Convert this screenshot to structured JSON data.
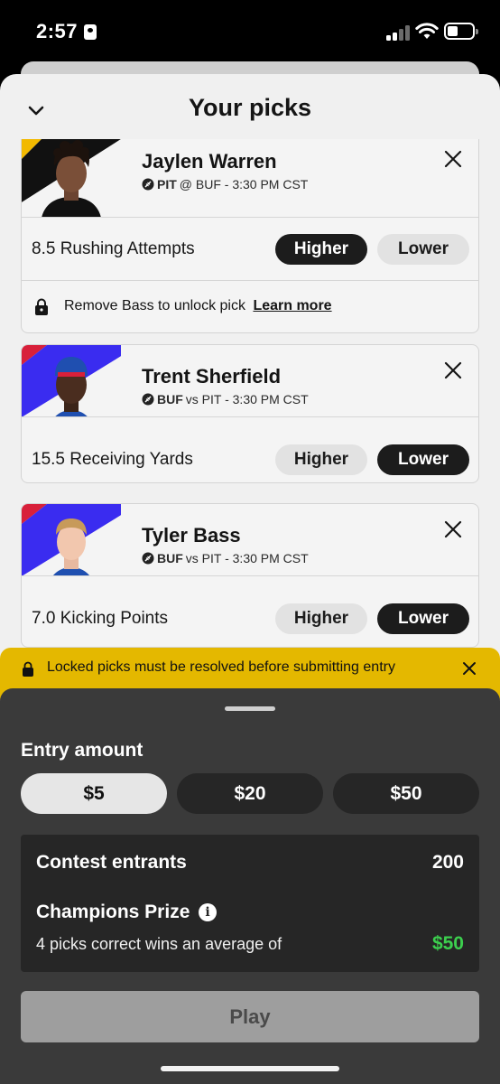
{
  "status_bar": {
    "time": "2:57"
  },
  "sheet": {
    "title": "Your picks"
  },
  "picks": [
    {
      "player": "Jaylen Warren",
      "team": "PIT",
      "matchup": "@ BUF - 3:30 PM CST",
      "stat": "8.5 Rushing Attempts",
      "higher_label": "Higher",
      "lower_label": "Lower",
      "selected": "Higher",
      "locked_text": "Remove Bass to unlock pick",
      "learn_more": "Learn more",
      "colors": {
        "primary": "#111111",
        "secondary": "#f2b900"
      }
    },
    {
      "player": "Trent Sherfield",
      "team": "BUF",
      "matchup": "vs PIT - 3:30 PM CST",
      "stat": "15.5 Receiving Yards",
      "higher_label": "Higher",
      "lower_label": "Lower",
      "selected": "Lower",
      "colors": {
        "primary": "#3a2cf0",
        "secondary": "#d8203a"
      }
    },
    {
      "player": "Tyler Bass",
      "team": "BUF",
      "matchup": "vs PIT - 3:30 PM CST",
      "stat": "7.0 Kicking Points",
      "higher_label": "Higher",
      "lower_label": "Lower",
      "selected": "Lower",
      "colors": {
        "primary": "#3a2cf0",
        "secondary": "#d8203a"
      }
    }
  ],
  "alert": {
    "text": "Locked picks must be resolved before submitting entry",
    "color": "#e4b800"
  },
  "entry": {
    "label": "Entry amount",
    "amounts": [
      "$5",
      "$20",
      "$50"
    ],
    "selected_amount": "$5",
    "contest_entrants_label": "Contest entrants",
    "contest_entrants_value": "200",
    "prize_label": "Champions Prize",
    "wins_label": "4 picks correct wins an average of",
    "wins_value": "$50",
    "play_label": "Play"
  }
}
